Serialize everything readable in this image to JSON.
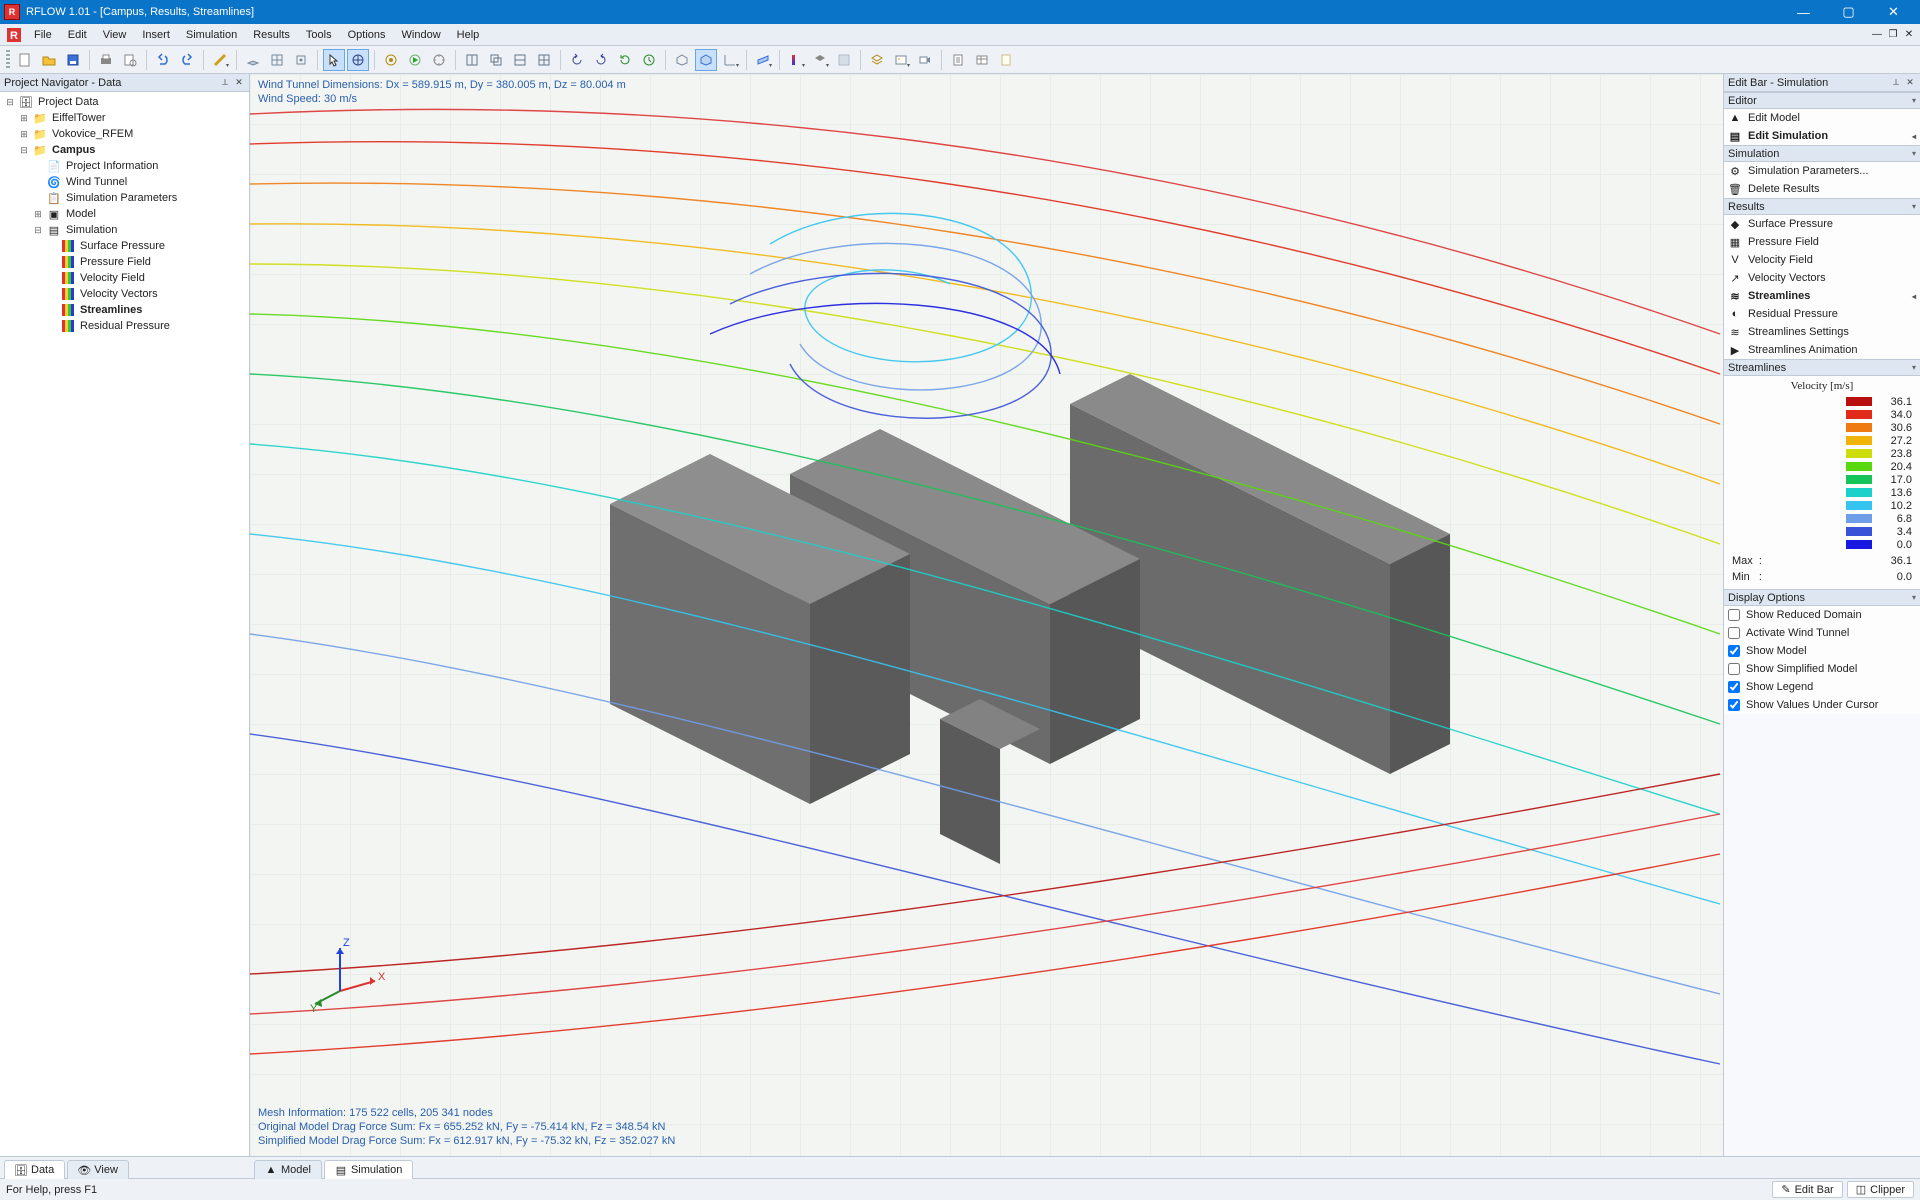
{
  "window": {
    "title": "RFLOW 1.01 - [Campus, Results, Streamlines]"
  },
  "menu": {
    "items": [
      "File",
      "Edit",
      "View",
      "Insert",
      "Simulation",
      "Results",
      "Tools",
      "Options",
      "Window",
      "Help"
    ]
  },
  "navigator": {
    "title": "Project Navigator - Data",
    "root": "Project Data",
    "projects": [
      "EiffelTower",
      "Vokovice_RFEM"
    ],
    "active_project": "Campus",
    "campus_children": [
      "Project Information",
      "Wind Tunnel",
      "Simulation Parameters",
      "Model",
      "Simulation"
    ],
    "sim_children": [
      "Surface Pressure",
      "Pressure Field",
      "Velocity Field",
      "Velocity Vectors",
      "Streamlines",
      "Residual Pressure"
    ]
  },
  "viewport": {
    "line1": "Wind Tunnel Dimensions: Dx = 589.915 m, Dy = 380.005 m, Dz = 80.004 m",
    "line2": "Wind Speed: 30 m/s",
    "mesh": "Mesh Information: 175 522 cells, 205 341 nodes",
    "drag1": "Original Model Drag Force Sum: Fx = 655.252 kN, Fy = -75.414 kN, Fz = 348.54 kN",
    "drag2": "Simplified Model Drag Force Sum: Fx = 612.917 kN, Fy = -75.32 kN, Fz = 352.027 kN",
    "axes": {
      "x": "X",
      "y": "Y",
      "z": "Z"
    }
  },
  "editbar": {
    "title": "Edit Bar - Simulation",
    "sections": {
      "editor": "Editor",
      "simulation": "Simulation",
      "results": "Results",
      "streamlines": "Streamlines",
      "display": "Display Options"
    },
    "editor_items": [
      "Edit Model",
      "Edit Simulation"
    ],
    "sim_items": [
      "Simulation Parameters...",
      "Delete Results"
    ],
    "result_items": [
      "Surface Pressure",
      "Pressure Field",
      "Velocity Field",
      "Velocity Vectors",
      "Streamlines",
      "Residual Pressure",
      "Streamlines Settings",
      "Streamlines Animation"
    ],
    "legend": {
      "title": "Velocity [m/s]",
      "rows": [
        {
          "c": "#b80f0f",
          "v": "36.1"
        },
        {
          "c": "#e02a1a",
          "v": "34.0"
        },
        {
          "c": "#ef7a12",
          "v": "30.6"
        },
        {
          "c": "#f1b40b",
          "v": "27.2"
        },
        {
          "c": "#cddd0b",
          "v": "23.8"
        },
        {
          "c": "#58d80e",
          "v": "20.4"
        },
        {
          "c": "#16c45a",
          "v": "17.0"
        },
        {
          "c": "#1bd1c9",
          "v": "13.6"
        },
        {
          "c": "#35c4ef",
          "v": "10.2"
        },
        {
          "c": "#6f9ee8",
          "v": "6.8"
        },
        {
          "c": "#3a52d8",
          "v": "3.4"
        },
        {
          "c": "#1818e0",
          "v": "0.0"
        }
      ],
      "max_l": "Max",
      "max_v": "36.1",
      "min_l": "Min",
      "min_v": "0.0",
      "colon": ":"
    },
    "display": [
      {
        "label": "Show Reduced Domain",
        "checked": false
      },
      {
        "label": "Activate Wind Tunnel",
        "checked": false
      },
      {
        "label": "Show Model",
        "checked": true
      },
      {
        "label": "Show Simplified Model",
        "checked": false
      },
      {
        "label": "Show Legend",
        "checked": true
      },
      {
        "label": "Show Values Under Cursor",
        "checked": true
      }
    ]
  },
  "bottom_tabs": {
    "left": [
      {
        "label": "Data",
        "icon": "data"
      },
      {
        "label": "View",
        "icon": "view"
      }
    ],
    "mid": [
      {
        "label": "Model",
        "icon": "model"
      },
      {
        "label": "Simulation",
        "icon": "sim"
      }
    ]
  },
  "status": {
    "help": "For Help, press F1",
    "right": [
      "Edit Bar",
      "Clipper"
    ]
  }
}
